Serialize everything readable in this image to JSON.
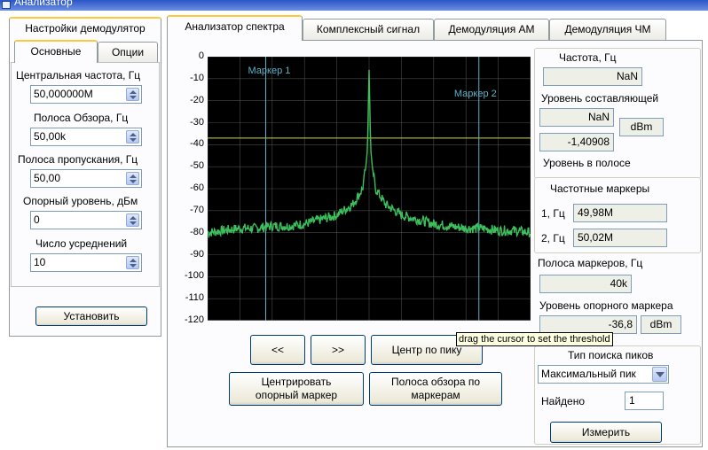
{
  "window": {
    "title": "Анализатор"
  },
  "left": {
    "tab_label": "Настройки демодулятор",
    "subtabs": [
      "Основные",
      "Опции"
    ],
    "fields": [
      {
        "label": "Центральная частота, Гц",
        "value": "50,000000M"
      },
      {
        "label": "Полоса Обзора, Гц",
        "value": "50,00k"
      },
      {
        "label": "Полоса пропускания, Гц",
        "value": "50,00"
      },
      {
        "label": "Опорный уровень, дБм",
        "value": "0"
      },
      {
        "label": "Число усреднений",
        "value": "10"
      }
    ],
    "apply_button": "Установить"
  },
  "tabs": [
    "Анализатор спектра",
    "Комплексный сигнал",
    "Демодуляция АМ",
    "Демодуляция ЧМ"
  ],
  "chart_data": {
    "type": "line",
    "title": "",
    "xlabel": "",
    "ylabel": "",
    "ylim": [
      -120,
      0
    ],
    "yticks": [
      "0",
      "-10",
      "-20",
      "-30",
      "-40",
      "-50",
      "-60",
      "-70",
      "-80",
      "-90",
      "-100",
      "-110",
      "-120"
    ],
    "grid": true,
    "background": "#000000",
    "series": [
      {
        "color": "#3cbf5c",
        "x": [
          0,
          0.05,
          0.1,
          0.15,
          0.2,
          0.25,
          0.3,
          0.35,
          0.4,
          0.45,
          0.48,
          0.49,
          0.495,
          0.5,
          0.505,
          0.51,
          0.52,
          0.55,
          0.6,
          0.65,
          0.7,
          0.75,
          0.8,
          0.85,
          0.9,
          0.95,
          1.0
        ],
        "values": [
          -80,
          -79,
          -78,
          -78,
          -77,
          -77,
          -76,
          -74,
          -72,
          -67,
          -60,
          -50,
          -42,
          -6,
          -42,
          -50,
          -60,
          -67,
          -72,
          -74,
          -76,
          -77,
          -78,
          -78,
          -79,
          -79,
          -80
        ]
      }
    ],
    "threshold": -37,
    "markers": [
      {
        "name": "Маркер 1",
        "x": 0.18
      },
      {
        "name": "Маркер 2",
        "x": 0.84
      }
    ],
    "colors": {
      "grid": "#4a4a4a",
      "marker": "#5bb3c9",
      "threshold": "#d8d83a"
    }
  },
  "controls": {
    "prev": "<<",
    "next": ">>",
    "center_peak": "Центр по пику",
    "center_ref": "Центрировать опорный маркер",
    "span_markers": "Полоса обзора по маркерам",
    "tooltip": "drag the cursor to set the threshold"
  },
  "right": {
    "freq_label": "Частота, Гц",
    "freq_value": "NaN",
    "comp_level_label": "Уровень составляющей",
    "comp_level_value": "NaN",
    "unit_dbm": "dBm",
    "band_level_value": "-1,40908",
    "band_level_label": "Уровень в полосе",
    "freq_markers_label": "Частотные маркеры",
    "m1_label": "1, Гц",
    "m1_value": "49,98M",
    "m2_label": "2, Гц",
    "m2_value": "50,02M",
    "marker_span_label": "Полоса маркеров, Гц",
    "marker_span_value": "40k",
    "ref_level_label": "Уровень опорного маркера",
    "ref_level_value": "-36,8",
    "ref_unit": "dBm",
    "peak_type_label": "Тип поиска пиков",
    "peak_type_value": "Максимальный пик",
    "found_label": "Найдено",
    "found_value": "1",
    "measure_button": "Измерить"
  }
}
